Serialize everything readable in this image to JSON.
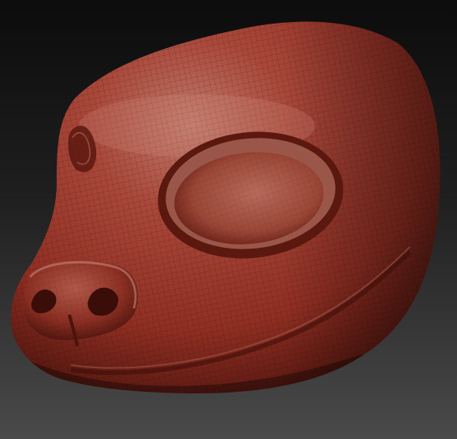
{
  "scene": {
    "subject_icon": "sculpted-animal-head-icon",
    "colors": {
      "background_top": "#0c0c0c",
      "background_bottom": "#4a4a4a",
      "clay_base": "#8f2e22",
      "clay_highlight": "#c07a6a",
      "clay_shadow": "#3a0d08",
      "wireframe": "#2a0804"
    }
  }
}
